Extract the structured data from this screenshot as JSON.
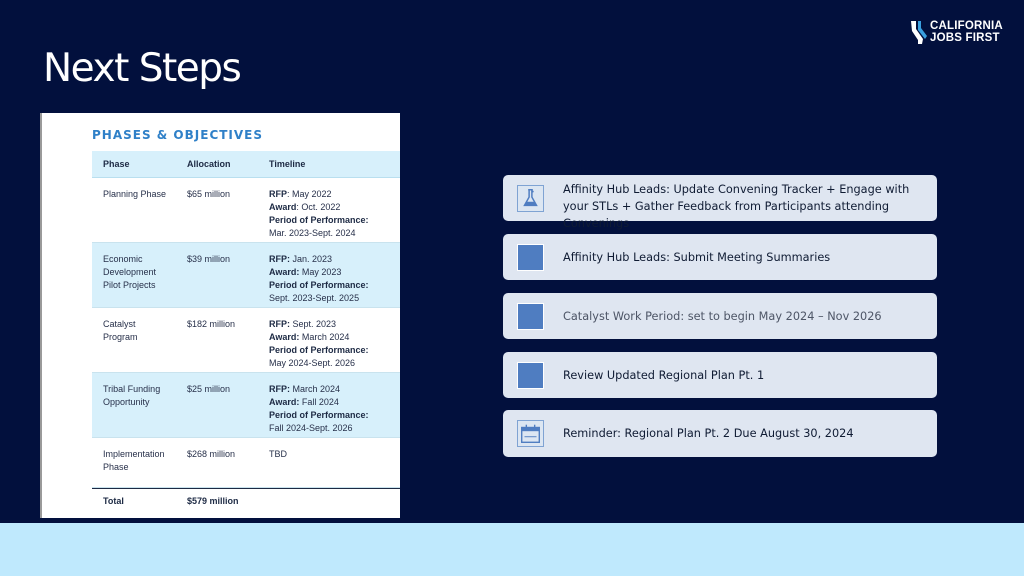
{
  "slide": {
    "title": "Next Steps"
  },
  "logo": {
    "line1": "CALIFORNIA",
    "line2": "JOBS FIRST"
  },
  "phases_table": {
    "heading": "PHASES & OBJECTIVES",
    "columns": [
      "Phase",
      "Allocation",
      "Timeline"
    ],
    "rows": [
      {
        "phase": [
          "Planning Phase"
        ],
        "allocation": "$65 million",
        "timeline": [
          {
            "label": "RFP",
            "sep": ": ",
            "value": "May 2022"
          },
          {
            "label": "Award",
            "sep": ": ",
            "value": "Oct. 2022"
          },
          {
            "label": "Period of Performance:",
            "sep": "",
            "value": ""
          },
          {
            "label": "",
            "sep": "",
            "value": "Mar. 2023-Sept. 2024"
          }
        ]
      },
      {
        "phase": [
          "Economic",
          "Development",
          "Pilot Projects"
        ],
        "allocation": "$39 million",
        "timeline": [
          {
            "label": "RFP:",
            "sep": " ",
            "value": "Jan. 2023"
          },
          {
            "label": "Award:",
            "sep": " ",
            "value": "May 2023"
          },
          {
            "label": "Period of Performance:",
            "sep": "",
            "value": ""
          },
          {
            "label": "",
            "sep": "",
            "value": "Sept. 2023-Sept. 2025"
          }
        ]
      },
      {
        "phase": [
          "Catalyst",
          "Program"
        ],
        "allocation": "$182 million",
        "timeline": [
          {
            "label": "RFP:",
            "sep": " ",
            "value": "Sept. 2023"
          },
          {
            "label": "Award:",
            "sep": " ",
            "value": "March 2024"
          },
          {
            "label": "Period of Performance:",
            "sep": "",
            "value": ""
          },
          {
            "label": "",
            "sep": "",
            "value": "May 2024-Sept. 2026"
          }
        ]
      },
      {
        "phase": [
          "Tribal Funding",
          "Opportunity"
        ],
        "allocation": "$25 million",
        "timeline": [
          {
            "label": "RFP:",
            "sep": " ",
            "value": "March 2024"
          },
          {
            "label": "Award:",
            "sep": " ",
            "value": "Fall 2024"
          },
          {
            "label": "Period of Performance:",
            "sep": "",
            "value": ""
          },
          {
            "label": "",
            "sep": "",
            "value": "Fall 2024-Sept. 2026"
          }
        ]
      },
      {
        "phase": [
          "Implementation",
          "Phase"
        ],
        "allocation": "$268 million",
        "timeline": [
          {
            "label": "",
            "sep": "",
            "value": "TBD"
          }
        ]
      }
    ],
    "total": {
      "label": "Total",
      "value": "$579 million"
    }
  },
  "steps": [
    {
      "text": "Affinity Hub Leads: Update Convening Tracker + Engage with your STLs + Gather Feedback from Participants attending Convenings",
      "icon": "flask-icon",
      "muted": false
    },
    {
      "text": "Affinity Hub Leads: Submit Meeting Summaries",
      "icon": "square-icon",
      "muted": false
    },
    {
      "text": "Catalyst Work Period: set to begin May 2024 – Nov 2026",
      "icon": "square-icon",
      "muted": true
    },
    {
      "text": "Review Updated Regional Plan Pt. 1",
      "icon": "square-icon",
      "muted": false
    },
    {
      "text": "Reminder: Regional Plan Pt. 2 Due August 30, 2024",
      "icon": "calendar-icon",
      "muted": false
    }
  ],
  "colors": {
    "background": "#02103d",
    "accent_blue": "#4f7dc1",
    "table_heading": "#2f80c8",
    "table_shade": "#d7f0fb",
    "step_card": "#dfe6f1",
    "bottom_band": "#bfe9fd"
  }
}
